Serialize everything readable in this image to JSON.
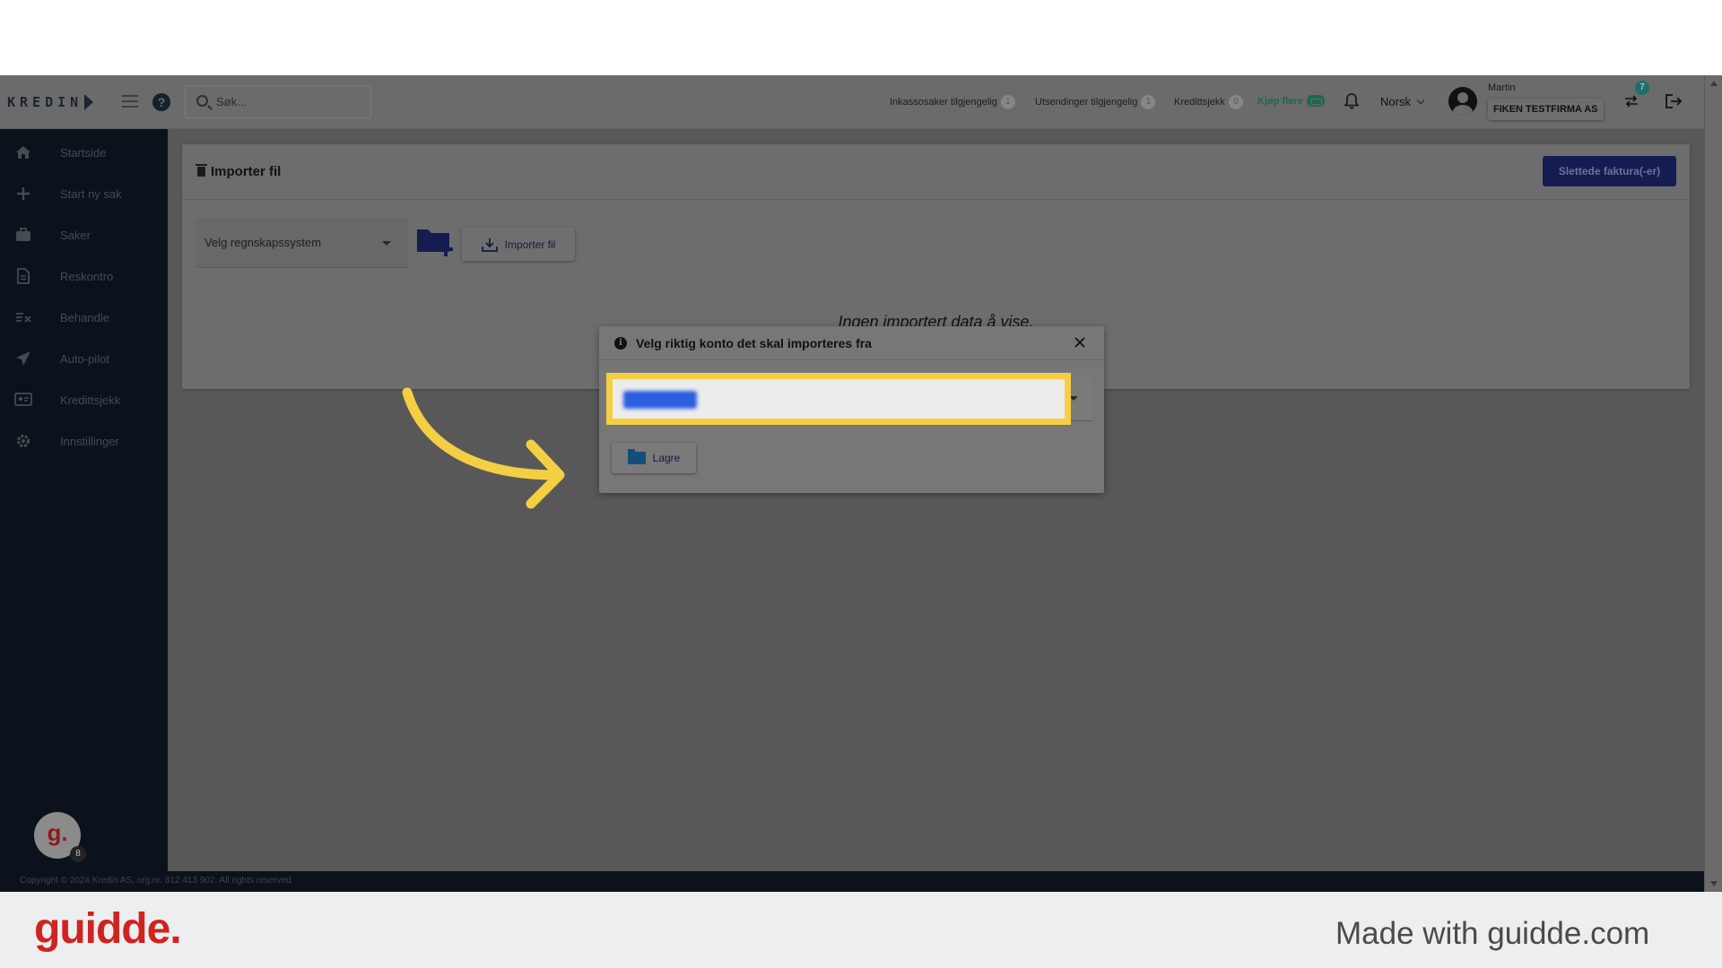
{
  "app": {
    "logo_text": "KREDIN",
    "search": {
      "placeholder": "Søk..."
    },
    "quotas": [
      {
        "label": "Inkassosaker tilgjengelig",
        "count": "1"
      },
      {
        "label": "Utsendinger tilgjengelig",
        "count": "1"
      },
      {
        "label": "Kredittsjekk",
        "count": "0"
      }
    ],
    "buy_more_label": "Kjøp flere",
    "language": "Norsk",
    "user": {
      "name": "Martin",
      "company": "FIKEN TESTFIRMA AS"
    },
    "switch_badge": "7"
  },
  "sidebar": {
    "items": [
      {
        "label": "Startside",
        "icon": "home-icon"
      },
      {
        "label": "Start ny sak",
        "icon": "plus-icon"
      },
      {
        "label": "Saker",
        "icon": "briefcase-icon"
      },
      {
        "label": "Reskontro",
        "icon": "document-icon"
      },
      {
        "label": "Behandle",
        "icon": "checklist-icon"
      },
      {
        "label": "Auto-pilot",
        "icon": "airplane-icon"
      },
      {
        "label": "Kredittsjekk",
        "icon": "id-card-icon"
      },
      {
        "label": "Innstillinger",
        "icon": "gear-icon"
      }
    ],
    "guidde_avatar": {
      "letter": "g.",
      "badge": "8"
    }
  },
  "card": {
    "title": "Importer fil",
    "deleted_button": "Slettede faktura(-er)",
    "system_select": "Velg regnskapssystem",
    "import_button": "Importer fil",
    "empty_message": "Ingen importert data å vise."
  },
  "modal": {
    "title": "Velg riktig konto det skal importeres fra",
    "save_button": "Lagre"
  },
  "footer": {
    "copyright": "Copyright © 2024 Kredin AS, org.nr. 812 413 902. All rights reserved."
  },
  "branding": {
    "logo": "guidde.",
    "made_with": "Made with guidde.com"
  },
  "colors": {
    "sidebar_bg": "#0b121b",
    "highlight": "#f5cf43",
    "brand_red": "#d0231f",
    "primary_button": "#151c52"
  }
}
